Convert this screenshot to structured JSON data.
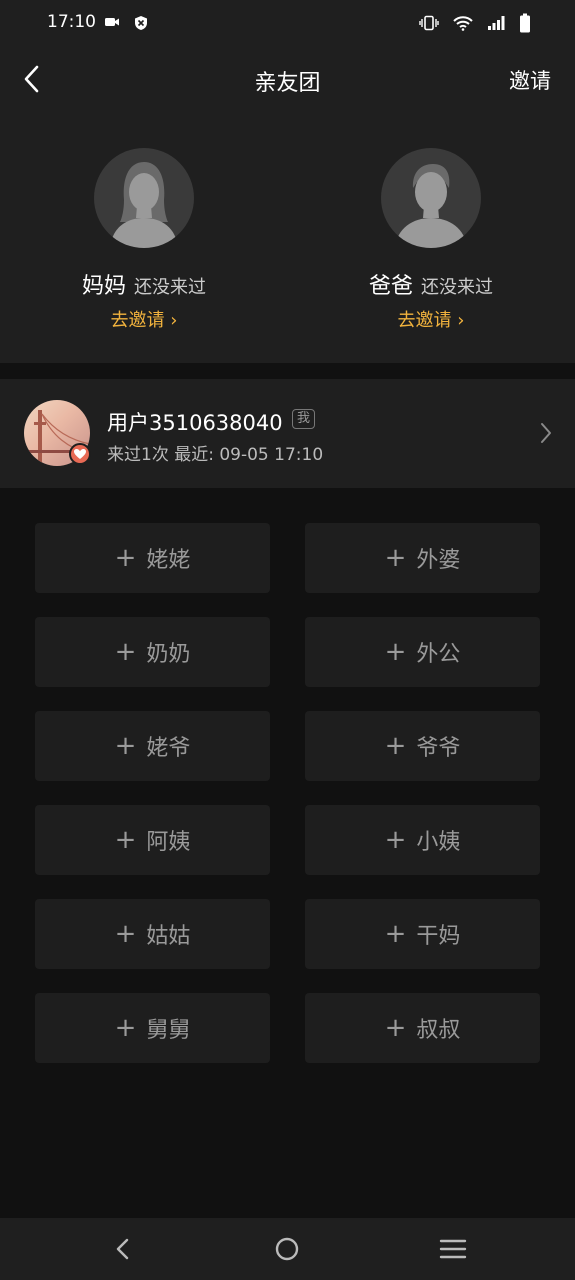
{
  "status": {
    "time": "17:10"
  },
  "header": {
    "title": "亲友团",
    "invite_label": "邀请"
  },
  "parents": [
    {
      "name": "妈妈",
      "status": "还没来过",
      "invite": "去邀请 ›"
    },
    {
      "name": "爸爸",
      "status": "还没来过",
      "invite": "去邀请 ›"
    }
  ],
  "user": {
    "name": "用户3510638040",
    "tag": "我",
    "visits": "来过1次  最近: 09-05 17:10"
  },
  "relations": [
    "姥姥",
    "外婆",
    "奶奶",
    "外公",
    "姥爷",
    "爷爷",
    "阿姨",
    "小姨",
    "姑姑",
    "干妈",
    "舅舅",
    "叔叔"
  ],
  "colors": {
    "accent": "#f2b33d",
    "panel": "#1f1f1f",
    "background": "#111111"
  }
}
